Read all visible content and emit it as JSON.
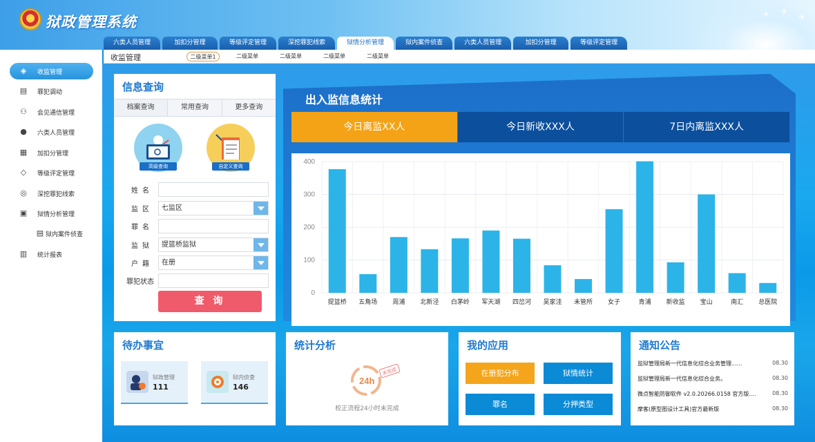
{
  "app": {
    "title": "狱政管理系统"
  },
  "tabs": [
    {
      "label": "六类人员管理"
    },
    {
      "label": "加扣分管理"
    },
    {
      "label": "等级评定管理"
    },
    {
      "label": "深挖罪犯线索"
    },
    {
      "label": "狱情分析管理"
    },
    {
      "label": "狱内案件侦查"
    },
    {
      "label": "六类人员管理"
    },
    {
      "label": "加扣分管理"
    },
    {
      "label": "等级评定管理"
    }
  ],
  "subbar": {
    "breadcrumb": "收监管理",
    "items": [
      {
        "label": "二级菜单1"
      },
      {
        "label": "二级菜单"
      },
      {
        "label": "二级菜单"
      },
      {
        "label": "二级菜单"
      },
      {
        "label": "二级菜单"
      }
    ]
  },
  "sidebar": {
    "items": [
      {
        "label": "收监管理"
      },
      {
        "label": "罪犯调动"
      },
      {
        "label": "会见通信管理"
      },
      {
        "label": "六类人员管理"
      },
      {
        "label": "加扣分管理"
      },
      {
        "label": "等级评定管理"
      },
      {
        "label": "深挖罪犯线索"
      },
      {
        "label": "狱情分析管理"
      },
      {
        "label": "狱内案件侦查"
      },
      {
        "label": "统计报表"
      }
    ]
  },
  "query": {
    "title": "信息查询",
    "tabs": [
      {
        "label": "档案查询"
      },
      {
        "label": "常用查询"
      },
      {
        "label": "更多查询"
      }
    ],
    "advanced": "高级查询",
    "custom": "自定义查询",
    "fields": {
      "name": {
        "label": "姓名",
        "value": ""
      },
      "area": {
        "label": "监区",
        "value": "七监区"
      },
      "crime": {
        "label": "罪名",
        "value": ""
      },
      "prison": {
        "label": "监狱",
        "value": "提篮桥监狱"
      },
      "household": {
        "label": "户籍",
        "value": "在册"
      },
      "status": {
        "label": "罪犯状态",
        "value": ""
      }
    },
    "submit": "查 询"
  },
  "stats": {
    "title": "出入监信息统计",
    "tabs": [
      {
        "label": "今日离监XX人"
      },
      {
        "label": "今日新收XXX人"
      },
      {
        "label": "7日内离监XXX人"
      }
    ]
  },
  "chart_data": {
    "type": "bar",
    "categories": [
      "提篮桥",
      "五角场",
      "周浦",
      "北新泾",
      "白茅岭",
      "军天湖",
      "四岔河",
      "吴家洼",
      "未管所",
      "女子",
      "青浦",
      "新收监",
      "宝山",
      "南汇",
      "总医院"
    ],
    "values": [
      377,
      57,
      170,
      133,
      166,
      190,
      165,
      84,
      42,
      255,
      401,
      93,
      300,
      60,
      30
    ],
    "ylim": [
      0,
      400
    ],
    "yticks": [
      0,
      100,
      200,
      300,
      400
    ],
    "grid": true,
    "color": "#2cb4e8"
  },
  "todo": {
    "title": "待办事宜",
    "items": [
      {
        "label": "狱政管理",
        "value": "111"
      },
      {
        "label": "狱内侦查",
        "value": "146"
      }
    ]
  },
  "analysis": {
    "title": "统计分析",
    "stamp": "未完成",
    "badge": "24h",
    "caption": "校正流程24小时未完成"
  },
  "apps": {
    "title": "我的应用",
    "items": [
      {
        "label": "在册犯分布"
      },
      {
        "label": "狱情统计"
      },
      {
        "label": "罪名"
      },
      {
        "label": "分押类型"
      }
    ]
  },
  "notices": {
    "title": "通知公告",
    "items": [
      {
        "text": "监狱管理局新一代信息化综合业务管理......",
        "date": "08.30"
      },
      {
        "text": "监狱管理局新一代信息化综合业务。",
        "date": "08.30"
      },
      {
        "text": "微点智能防御软件 v2.0.20266.0158 官方版....",
        "date": "08.30"
      },
      {
        "text": "摩客(原型图设计工具)官方最新版",
        "date": "08.30"
      }
    ]
  },
  "colors": {
    "accent": "#1f7ad0",
    "orange": "#f5a316",
    "danger": "#ef5b6b",
    "navy": "#0b4f9d"
  }
}
